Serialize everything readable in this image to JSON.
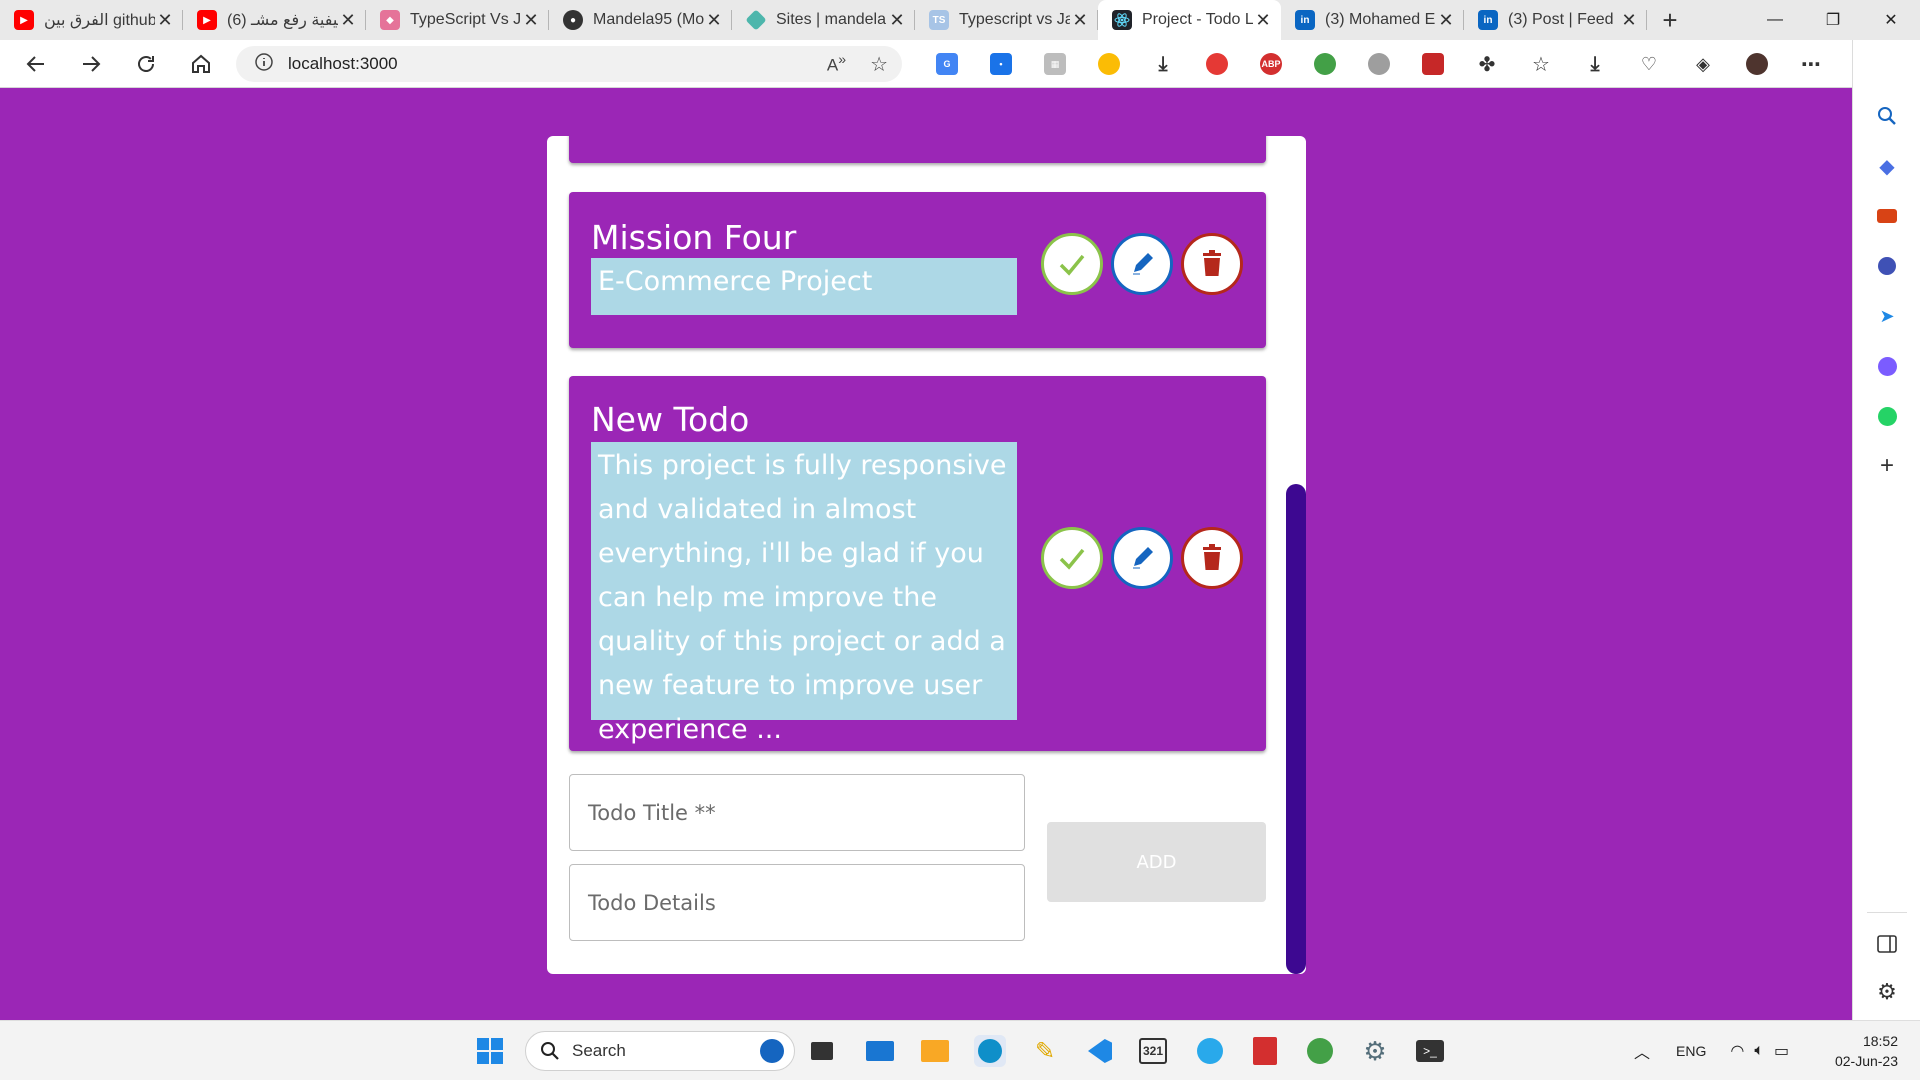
{
  "browser": {
    "tabs": [
      {
        "title": "الفرق بين github",
        "favicon": "youtube-icon",
        "color": "#ff0000"
      },
      {
        "title": "(6) كيفية رفع مشـ",
        "favicon": "youtube-icon",
        "color": "#ff0000"
      },
      {
        "title": "TypeScript Vs Ja",
        "favicon": "cube-icon",
        "color": "#e57399"
      },
      {
        "title": "Mandela95 (Mo",
        "favicon": "github-icon",
        "color": "#333333"
      },
      {
        "title": "Sites | mandela",
        "favicon": "diamond-icon",
        "color": "#4db6ac"
      },
      {
        "title": "Typescript vs Ja",
        "favicon": "ts-icon",
        "color": "#a7c4e6"
      },
      {
        "title": "Project - Todo L",
        "favicon": "react-icon",
        "color": "#20232a"
      },
      {
        "title": "(3) Mohamed E",
        "favicon": "linkedin-icon",
        "color": "#0a66c2"
      },
      {
        "title": "(3) Post | Feed |",
        "favicon": "linkedin-icon",
        "color": "#0a66c2"
      }
    ],
    "active_tab": 6,
    "url": "localhost:3000"
  },
  "todos": [
    {
      "title": "Mission Four",
      "details": "E-Commerce Project"
    },
    {
      "title": "New Todo",
      "details": "This project is fully responsive and validated in almost everything, i'll be glad if you can help me improve the quality of this project or add a new feature to improve user experience ..."
    }
  ],
  "form": {
    "title_placeholder": "Todo Title **",
    "details_placeholder": "Todo Details",
    "add_label": "ADD"
  },
  "taskbar": {
    "search_label": "Search",
    "language": "ENG",
    "time": "18:52",
    "date": "02-Jun-23"
  },
  "colors": {
    "page_bg": "#9b26b6",
    "todo_bg": "#9b26b6",
    "details_bg": "#add8e6",
    "scrollbar": "#3d0891",
    "complete": "#8bc34a",
    "edit": "#1565c0",
    "delete": "#b5281c"
  }
}
